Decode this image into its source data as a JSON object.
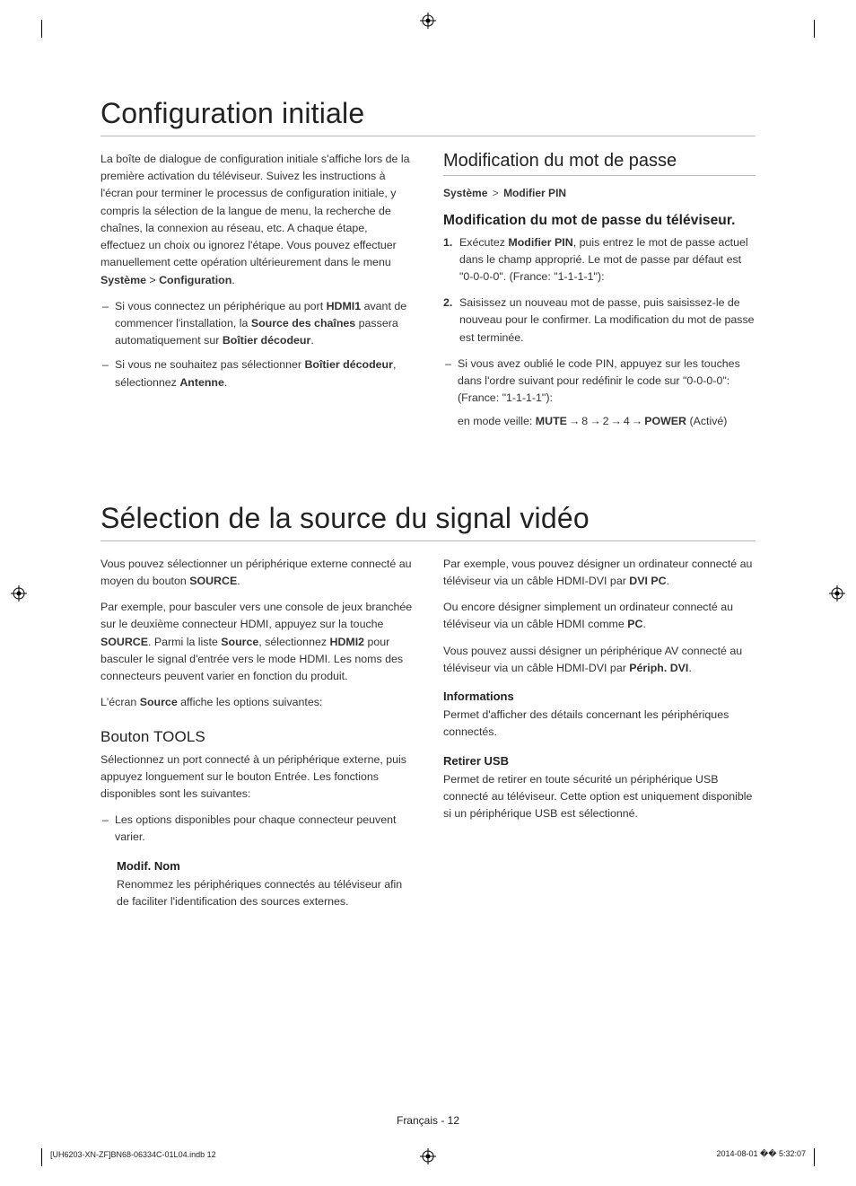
{
  "crop_marks": true,
  "registration_marks": [
    "top-center",
    "left-center",
    "right-center",
    "bottom-center"
  ],
  "section1": {
    "title": "Configuration initiale",
    "left": {
      "intro_parts": [
        "La boîte de dialogue de configuration initiale s'affiche lors de la première activation du téléviseur. Suivez les instructions à l'écran pour terminer le processus de configuration initiale, y compris la sélection de la langue de menu, la recherche de chaînes, la connexion au réseau, etc. A chaque étape, effectuez un choix ou ignorez l'étape. Vous pouvez effectuer manuellement cette opération ultérieurement dans le menu ",
        "Système",
        " > ",
        "Configuration",
        "."
      ],
      "bullets": [
        {
          "parts": [
            "Si vous connectez un périphérique au port ",
            "HDMI1",
            " avant de commencer l'installation, la ",
            "Source des chaînes",
            " passera automatiquement sur ",
            "Boîtier décodeur",
            "."
          ]
        },
        {
          "parts": [
            "Si vous ne souhaitez pas sélectionner ",
            "Boîtier décodeur",
            ", sélectionnez ",
            "Antenne",
            "."
          ]
        }
      ]
    },
    "right": {
      "heading": "Modification du mot de passe",
      "path": {
        "a": "Système",
        "b": "Modifier PIN"
      },
      "sub": "Modification du mot de passe du téléviseur.",
      "steps": [
        {
          "parts": [
            "Exécutez ",
            "Modifier PIN",
            ", puis entrez le mot de passe actuel dans le champ approprié. Le mot de passe par défaut est \"0-0-0-0\". (France: \"1-1-1-1\"):"
          ]
        },
        {
          "parts": [
            "Saisissez un nouveau mot de passe, puis saisissez-le de nouveau pour le confirmer. La modification du mot de passe est terminée."
          ]
        }
      ],
      "note": "Si vous avez oublié le code PIN, appuyez sur les touches dans l'ordre suivant pour redéfinir le code sur \"0-0-0-0\": (France: \"1-1-1-1\"):",
      "sequence_label": "en mode veille: ",
      "sequence": [
        "MUTE",
        "8",
        "2",
        "4",
        "POWER"
      ],
      "sequence_tail": " (Activé)"
    }
  },
  "section2": {
    "title": "Sélection de la source du signal vidéo",
    "left": {
      "p1_parts": [
        "Vous pouvez sélectionner un périphérique externe connecté au moyen du bouton ",
        "SOURCE",
        "."
      ],
      "p2_parts": [
        "Par exemple, pour basculer vers une console de jeux branchée sur le deuxième connecteur HDMI, appuyez sur la touche ",
        "SOURCE",
        ". Parmi la liste ",
        "Source",
        ", sélectionnez ",
        "HDMI2",
        " pour basculer le signal d'entrée vers le mode HDMI. Les noms des connecteurs peuvent varier en fonction du produit."
      ],
      "p3_parts": [
        "L'écran ",
        "Source",
        " affiche les options suivantes:"
      ],
      "tools_heading": "Bouton TOOLS",
      "tools_intro": "Sélectionnez un port connecté à un périphérique externe, puis appuyez longuement sur le bouton Entrée. Les fonctions disponibles sont les suivantes:",
      "tools_note": "Les options disponibles pour chaque connecteur peuvent varier.",
      "modif_nom_heading": "Modif. Nom",
      "modif_nom_body": "Renommez les périphériques connectés au téléviseur afin de faciliter l'identification des sources externes."
    },
    "right": {
      "p1_parts": [
        "Par exemple, vous pouvez désigner un ordinateur connecté au téléviseur via un câble HDMI-DVI par ",
        "DVI PC",
        "."
      ],
      "p2_parts": [
        "Ou encore désigner simplement un ordinateur connecté au téléviseur via un câble HDMI comme ",
        "PC",
        "."
      ],
      "p3_parts": [
        "Vous pouvez aussi désigner un périphérique AV connecté au téléviseur via un câble HDMI-DVI par ",
        "Périph. DVI",
        "."
      ],
      "info_heading": "Informations",
      "info_body": "Permet d'afficher des détails concernant les périphériques connectés.",
      "usb_heading": "Retirer USB",
      "usb_body": "Permet de retirer en toute sécurité un périphérique USB connecté au téléviseur. Cette option est uniquement disponible si un périphérique USB est sélectionné."
    }
  },
  "footer": {
    "center": "Français - 12",
    "left": "[UH6203-XN-ZF]BN68-06334C-01L04.indb   12",
    "right": "2014-08-01   �� 5:32:07"
  }
}
